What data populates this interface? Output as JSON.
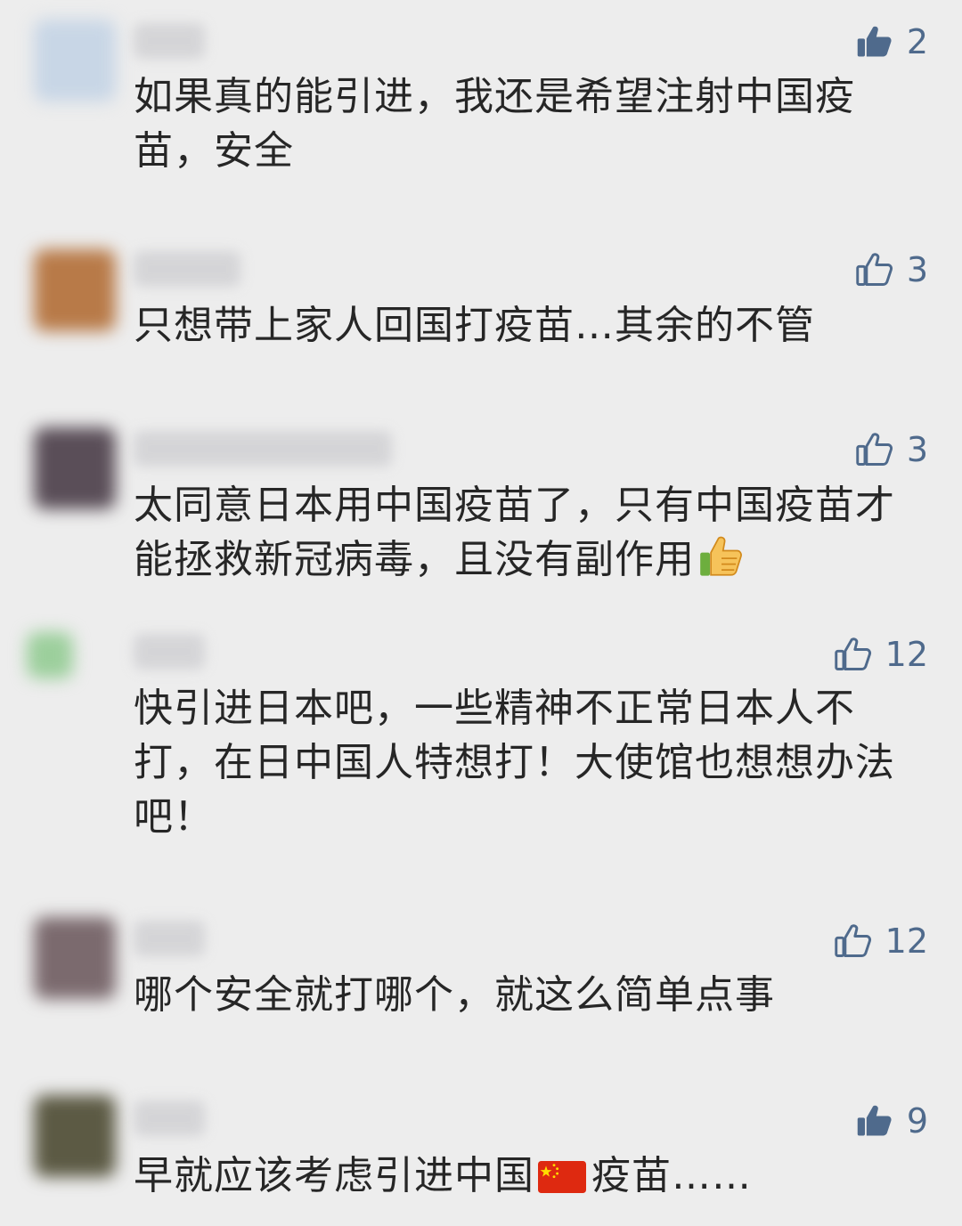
{
  "colors": {
    "background": "#ededed",
    "like_icon": "#4f6a8c",
    "text": "#262626"
  },
  "comments": [
    {
      "avatar_color": "#c8d6e6",
      "likes": "2",
      "like_icon": "thumbs-up-filled-icon",
      "text_lines": [
        "如果真的能引进，我还是希望注射中国疫",
        "苗，安全"
      ]
    },
    {
      "avatar_color": "#b87a48",
      "likes": "3",
      "like_icon": "thumbs-up-outline-icon",
      "text_lines": [
        "只想带上家人回国打疫苗…其余的不管"
      ]
    },
    {
      "avatar_color": "#5a4e58",
      "likes": "3",
      "like_icon": "thumbs-up-outline-icon",
      "text_lines": [
        "太同意日本用中国疫苗了，只有中国疫苗才",
        "能拯救新冠病毒，且没有副作用"
      ],
      "trailing_emoji": "thumbs-up-emoji"
    },
    {
      "avatar_color": "#9ccf9c",
      "likes": "12",
      "like_icon": "thumbs-up-outline-icon",
      "text_lines": [
        "快引进日本吧，一些精神不正常日本人不",
        "打，在日中国人特想打！大使馆也想想办法",
        "吧！"
      ]
    },
    {
      "avatar_color": "#7b6a6e",
      "likes": "12",
      "like_icon": "thumbs-up-outline-icon",
      "text_lines": [
        "哪个安全就打哪个，就这么简单点事"
      ]
    },
    {
      "avatar_color": "#5c5a44",
      "likes": "9",
      "like_icon": "thumbs-up-filled-icon",
      "text_segments": [
        "早就应该考虑引进中国",
        "疫苗……"
      ],
      "inline_emoji": "china-flag-emoji"
    }
  ]
}
